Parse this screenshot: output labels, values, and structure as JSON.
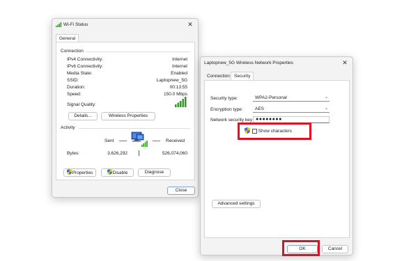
{
  "wifi_status": {
    "title": "Wi-Fi Status",
    "close": "✕",
    "tab_general": "General",
    "connection": {
      "heading": "Connection",
      "rows": [
        {
          "label": "IPv4 Connectivity:",
          "value": "Internet"
        },
        {
          "label": "IPv6 Connectivity:",
          "value": "Internet"
        },
        {
          "label": "Media State:",
          "value": "Enabled"
        },
        {
          "label": "SSID:",
          "value": "Laptopnew_5G"
        },
        {
          "label": "Duration:",
          "value": "00:13:55"
        },
        {
          "label": "Speed:",
          "value": "150.0 Mbps"
        }
      ],
      "signal_label": "Signal Quality:"
    },
    "details_button": "Details...",
    "wireless_properties_button": "Wireless Properties",
    "activity": {
      "heading": "Activity",
      "sent_label": "Sent",
      "received_label": "Received",
      "bytes_label": "Bytes:",
      "bytes_sent": "3,626,292",
      "bytes_received": "526,074,060"
    },
    "properties_button": "Properties",
    "disable_button": "Disable",
    "diagnose_button": "Diagnose",
    "close_button": "Close"
  },
  "network_properties": {
    "title": "Laptopnew_5G Wireless Network Properties",
    "close": "✕",
    "tab_connection": "Connection",
    "tab_security": "Security",
    "security_type_label": "Security type:",
    "security_type_value": "WPA2-Personal",
    "encryption_type_label": "Encryption type:",
    "encryption_type_value": "AES",
    "network_key_label": "Network security key",
    "network_key_value": "●●●●●●●●",
    "show_characters_label": "Show characters",
    "advanced_settings_button": "Advanced settings",
    "ok_button": "OK",
    "cancel_button": "Cancel"
  },
  "colors": {
    "highlight": "#e01020",
    "signal_green": "#2f9e1f"
  },
  "icons": [
    "wifi-signal-icon",
    "close-icon",
    "computer-network-icon",
    "uac-shield-icon",
    "chevron-down-icon",
    "checkbox-icon"
  ]
}
